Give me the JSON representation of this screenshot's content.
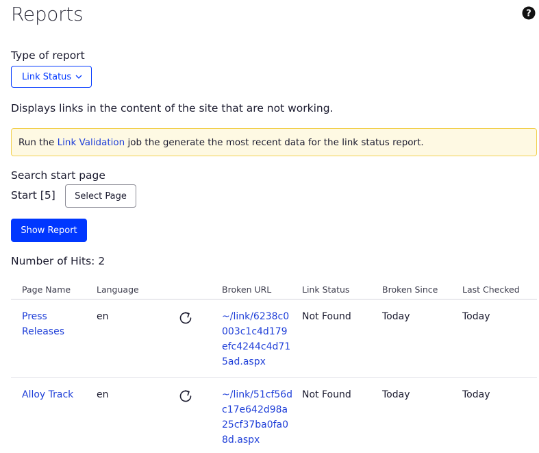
{
  "header": {
    "title": "Reports",
    "help_icon": "question-circle-icon"
  },
  "report_type": {
    "label": "Type of report",
    "selected": "Link Status"
  },
  "description": "Displays links in the content of the site that are not working.",
  "notice": {
    "prefix": "Run the ",
    "link_text": "Link Validation",
    "suffix": " job the generate the most recent data for the link status report.",
    "background": "#fef9e3",
    "border": "#f2d04f"
  },
  "search": {
    "label": "Search start page",
    "start_text": "Start [5]",
    "select_page_label": "Select Page"
  },
  "show_report_label": "Show Report",
  "hits_text": "Number of Hits: 2",
  "table": {
    "columns": [
      "Page Name",
      "Language",
      "Broken URL",
      "Link Status",
      "Broken Since",
      "Last Checked"
    ],
    "rows": [
      {
        "page_name_line1": "Press",
        "page_name_line2": "Releases",
        "language": "en",
        "broken_url": "~/link/6238c0003c1c4d179efc4244c4d715ad.aspx",
        "link_status": "Not Found",
        "broken_since": "Today",
        "last_checked": "Today"
      },
      {
        "page_name_line1": "Alloy Track",
        "language": "en",
        "broken_url": "~/link/51cf56dc17e642d98a25cf37ba0fa08d.aspx",
        "link_status": "Not Found",
        "broken_since": "Today",
        "last_checked": "Today"
      }
    ]
  },
  "colors": {
    "accent": "#0037ff",
    "link": "#1f3fd8"
  }
}
